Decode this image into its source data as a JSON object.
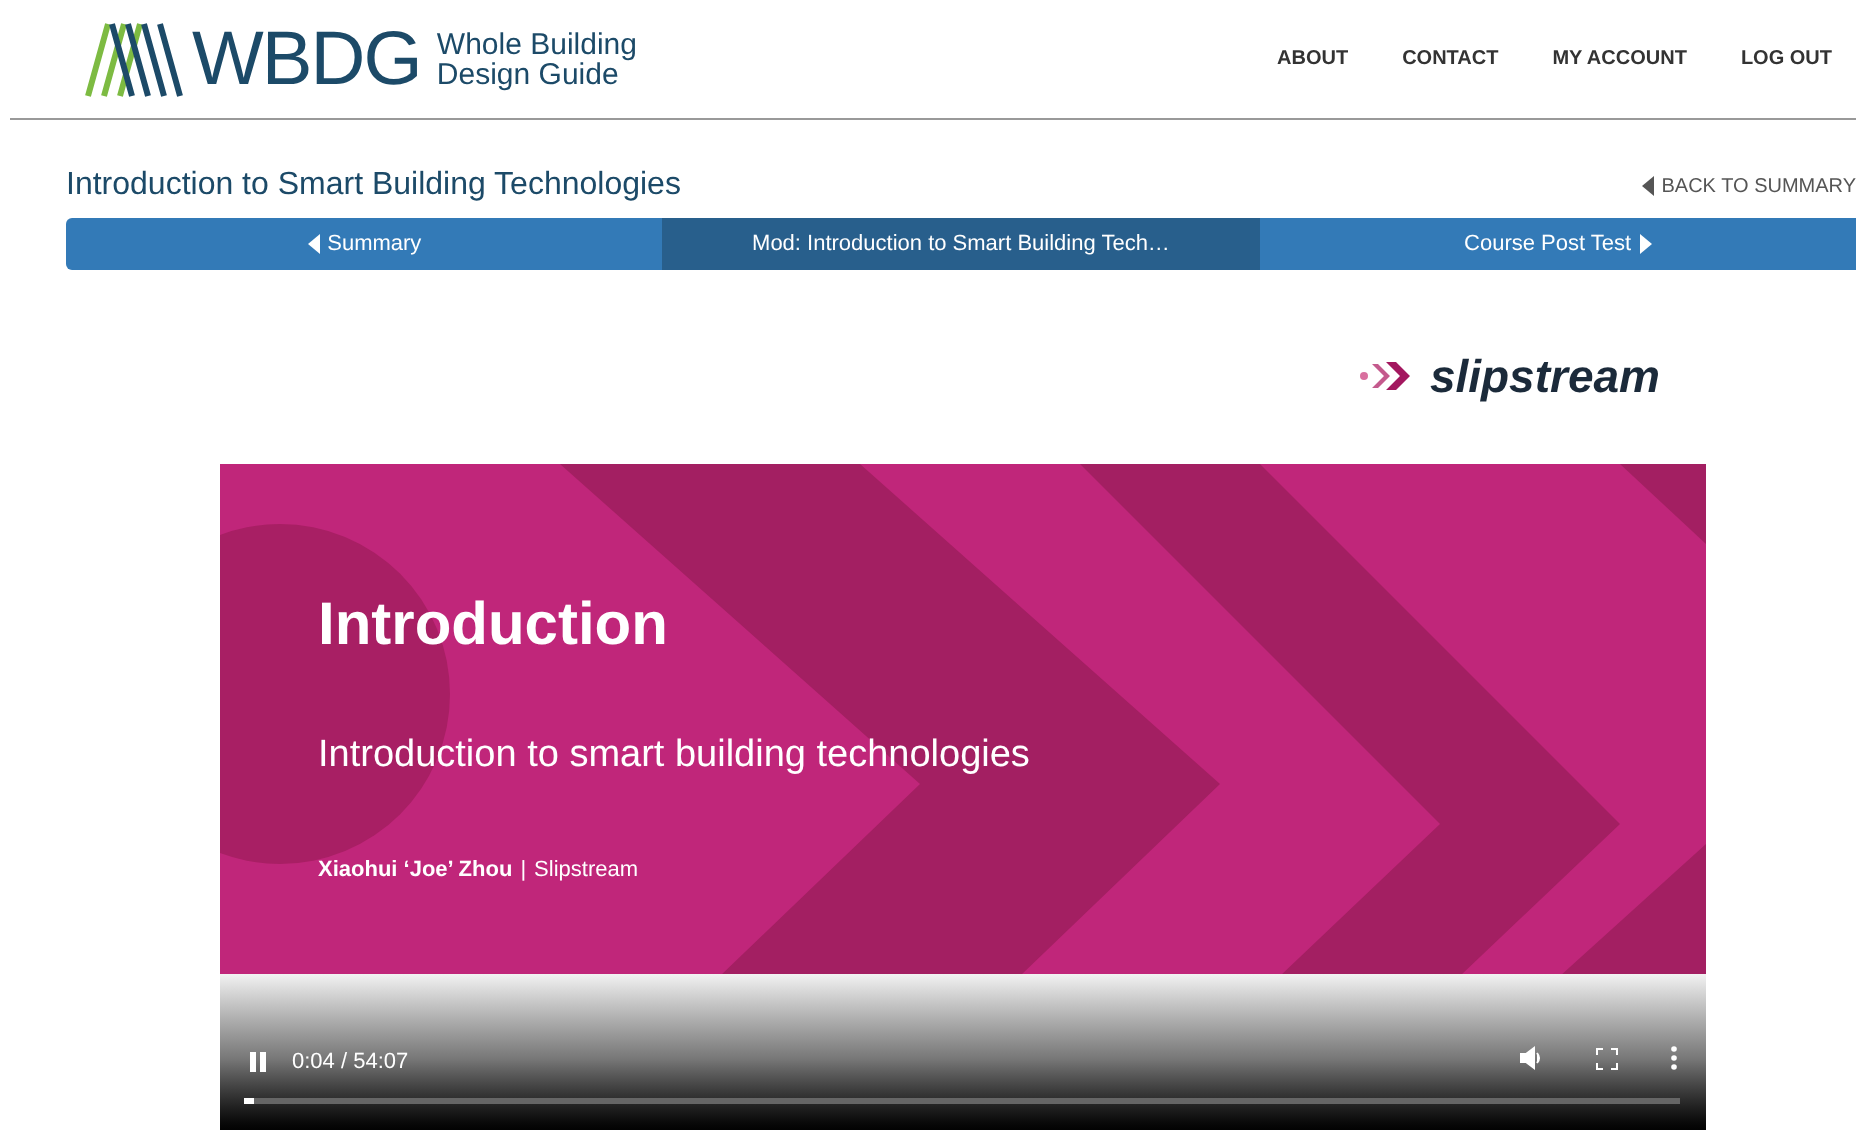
{
  "header": {
    "logo_text": "WBDG",
    "logo_subtitle": [
      "Whole Building",
      "Design Guide"
    ],
    "nav": [
      "ABOUT",
      "CONTACT",
      "MY ACCOUNT",
      "LOG OUT"
    ]
  },
  "course": {
    "title": "Introduction to Smart Building Technologies",
    "back_link": "BACK TO SUMMARY"
  },
  "steps": [
    {
      "label": "Summary",
      "kind": "prev",
      "selected": false
    },
    {
      "label": "Mod: Introduction to Smart Building Tech…",
      "kind": "current",
      "selected": true
    },
    {
      "label": "Course Post Test",
      "kind": "next",
      "selected": false
    }
  ],
  "sponsor": {
    "name": "slipstream"
  },
  "video": {
    "slide": {
      "heading": "Introduction",
      "subheading": "Introduction to smart building technologies",
      "presenter": "Xiaohui ‘Joe’ Zhou",
      "separator": "|",
      "organization": "Slipstream"
    },
    "playing": true,
    "time": "0:04 / 54:07",
    "progress": {
      "level": 0.007
    }
  }
}
